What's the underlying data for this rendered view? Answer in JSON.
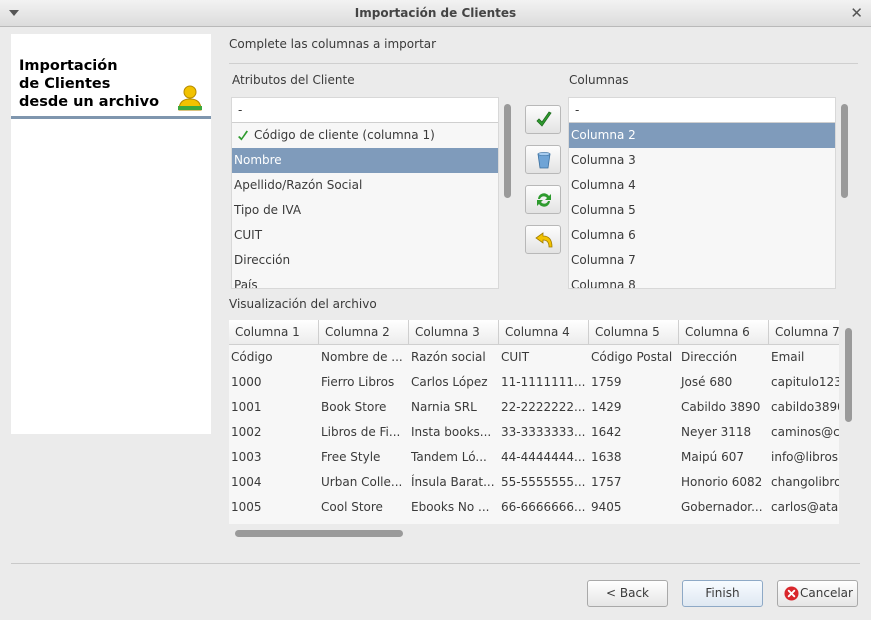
{
  "window": {
    "title": "Importación de Clientes",
    "close_glyph": "✕"
  },
  "sidebar": {
    "heading_lines": [
      "Importación",
      "de Clientes",
      "desde un archivo"
    ],
    "icon": "user-icon"
  },
  "main": {
    "instruction": "Complete las columnas a importar",
    "attributes": {
      "label": "Atributos del Cliente",
      "header": "-",
      "items": [
        {
          "label": "Código de cliente (columna 1)",
          "mapped": true,
          "selected": false
        },
        {
          "label": "Nombre",
          "mapped": false,
          "selected": true
        },
        {
          "label": "Apellido/Razón Social",
          "mapped": false,
          "selected": false
        },
        {
          "label": "Tipo de IVA",
          "mapped": false,
          "selected": false
        },
        {
          "label": "CUIT",
          "mapped": false,
          "selected": false
        },
        {
          "label": "Dirección",
          "mapped": false,
          "selected": false
        },
        {
          "label": "País",
          "mapped": false,
          "selected": false
        }
      ]
    },
    "columns": {
      "label": "Columnas",
      "header": "-",
      "items": [
        {
          "label": "Columna 2",
          "selected": true
        },
        {
          "label": "Columna 3",
          "selected": false
        },
        {
          "label": "Columna 4",
          "selected": false
        },
        {
          "label": "Columna 5",
          "selected": false
        },
        {
          "label": "Columna 6",
          "selected": false
        },
        {
          "label": "Columna 7",
          "selected": false
        },
        {
          "label": "Columna 8",
          "selected": false
        }
      ]
    },
    "tools": [
      "check-icon",
      "trash-icon",
      "refresh-icon",
      "undo-icon"
    ],
    "preview": {
      "label": "Visualización del archivo",
      "headers": [
        "Columna 1",
        "Columna 2",
        "Columna 3",
        "Columna 4",
        "Columna 5",
        "Columna 6",
        "Columna 7"
      ],
      "rows": [
        [
          "Código",
          "Nombre de ...",
          "Razón social",
          "CUIT",
          "Código Postal",
          "Dirección",
          "Email"
        ],
        [
          "1000",
          "Fierro Libros",
          "Carlos López",
          "11-1111111...",
          "1759",
          "José 680",
          "capitulo123"
        ],
        [
          "1001",
          "Book Store",
          "Narnia SRL",
          "22-2222222...",
          "1429",
          "Cabildo 3890",
          "cabildo3890"
        ],
        [
          "1002",
          "Libros de Fi...",
          "Insta books...",
          "33-3333333...",
          "1642",
          "Neyer 3118",
          "caminos@c"
        ],
        [
          "1003",
          "Free Style",
          "Tandem Ló...",
          "44-4444444...",
          "1638",
          "Maipú 607",
          "info@libros."
        ],
        [
          "1004",
          "Urban Colle...",
          "Ínsula Barat...",
          "55-5555555...",
          "1757",
          "Honorio 6082",
          "changolibro"
        ],
        [
          "1005",
          "Cool Store",
          "Ebooks No ...",
          "66-6666666...",
          "9405",
          "Gobernador...",
          "carlos@ata"
        ]
      ]
    }
  },
  "buttons": {
    "back": "< Back",
    "finish": "Finish",
    "cancel": "Cancelar"
  }
}
